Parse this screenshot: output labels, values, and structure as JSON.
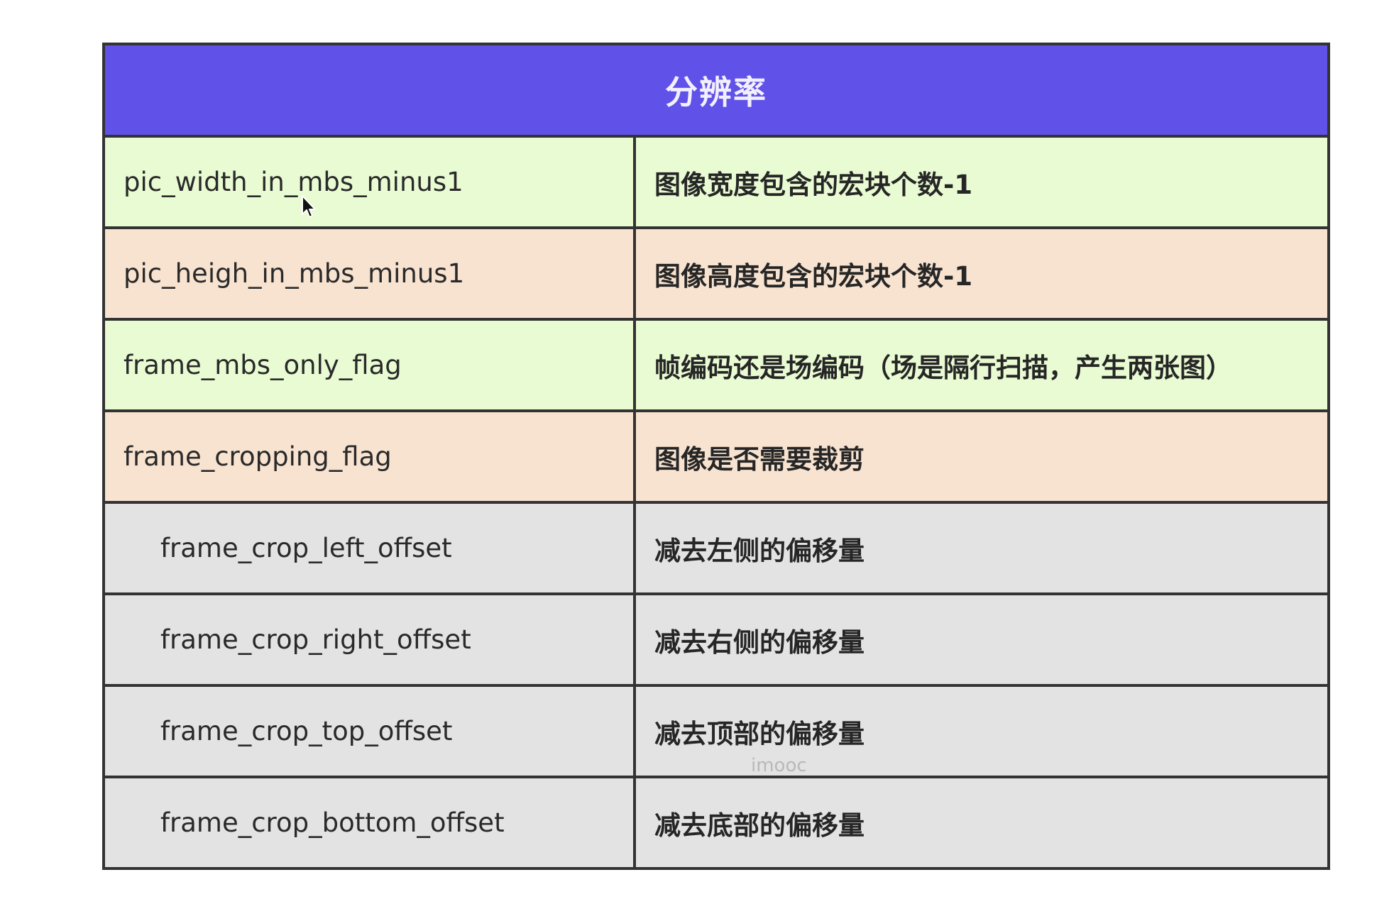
{
  "table": {
    "title": "分辨率",
    "rows": [
      {
        "name": "pic_width_in_mbs_minus1",
        "desc": "图像宽度包含的宏块个数-1"
      },
      {
        "name": "pic_heigh_in_mbs_minus1",
        "desc": "图像高度包含的宏块个数-1"
      },
      {
        "name": "frame_mbs_only_flag",
        "desc": "帧编码还是场编码（场是隔行扫描，产生两张图）"
      },
      {
        "name": "frame_cropping_flag",
        "desc": "图像是否需要裁剪"
      },
      {
        "name": "frame_crop_left_offset",
        "desc": "减去左侧的偏移量"
      },
      {
        "name": "frame_crop_right_offset",
        "desc": "减去右侧的偏移量"
      },
      {
        "name": "frame_crop_top_offset",
        "desc": "减去顶部的偏移量"
      },
      {
        "name": "frame_crop_bottom_offset",
        "desc": "减去底部的偏移量"
      }
    ]
  },
  "colors": {
    "header": "#6052e8",
    "green_row": "#e9fbd2",
    "peach_row": "#f8e3d0",
    "gray_row": "#e3e3e3",
    "border": "#333333"
  },
  "watermark": "imooc"
}
